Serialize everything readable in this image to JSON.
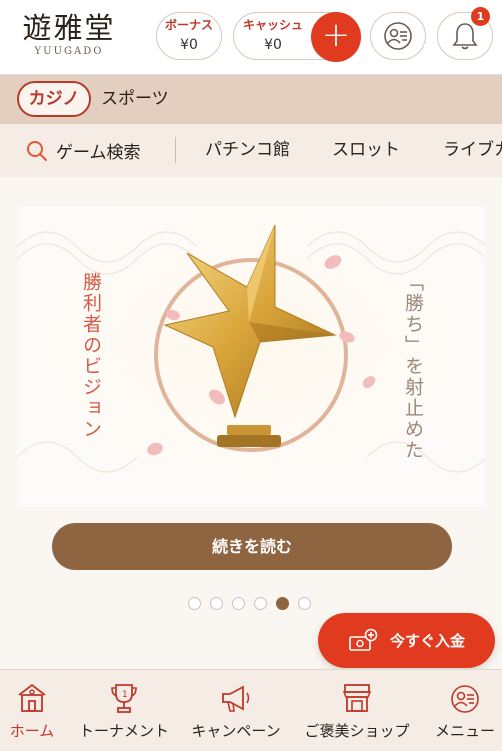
{
  "header": {
    "logo_main": "遊雅堂",
    "logo_sub": "YUUGADO",
    "bonus_label": "ボーナス",
    "bonus_value": "¥0",
    "cash_label": "キャッシュ",
    "cash_value": "¥0",
    "add_label": "+",
    "notification_count": "1"
  },
  "categories": {
    "active": "カジノ",
    "other": "スポーツ"
  },
  "sub_nav": {
    "search_label": "ゲーム検索",
    "items": [
      "パチンコ館",
      "スロット",
      "ライブカ"
    ]
  },
  "banner": {
    "left_text": "勝利者のビジョン",
    "right_text": "「勝ち」を射止めた",
    "button_label": "続きを読む",
    "slides_total": 6,
    "active_slide": 5
  },
  "deposit": {
    "label": "今すぐ入金"
  },
  "bottom_nav": [
    {
      "label": "ホーム",
      "icon": "home-icon",
      "active": true
    },
    {
      "label": "トーナメント",
      "icon": "trophy-icon",
      "active": false
    },
    {
      "label": "キャンペーン",
      "icon": "megaphone-icon",
      "active": false
    },
    {
      "label": "ご褒美ショップ",
      "icon": "shop-icon",
      "active": false
    },
    {
      "label": "メニュー",
      "icon": "menu-icon",
      "active": false
    }
  ],
  "colors": {
    "accent_red": "#e03a1f",
    "brand_brown": "#8f6440"
  }
}
